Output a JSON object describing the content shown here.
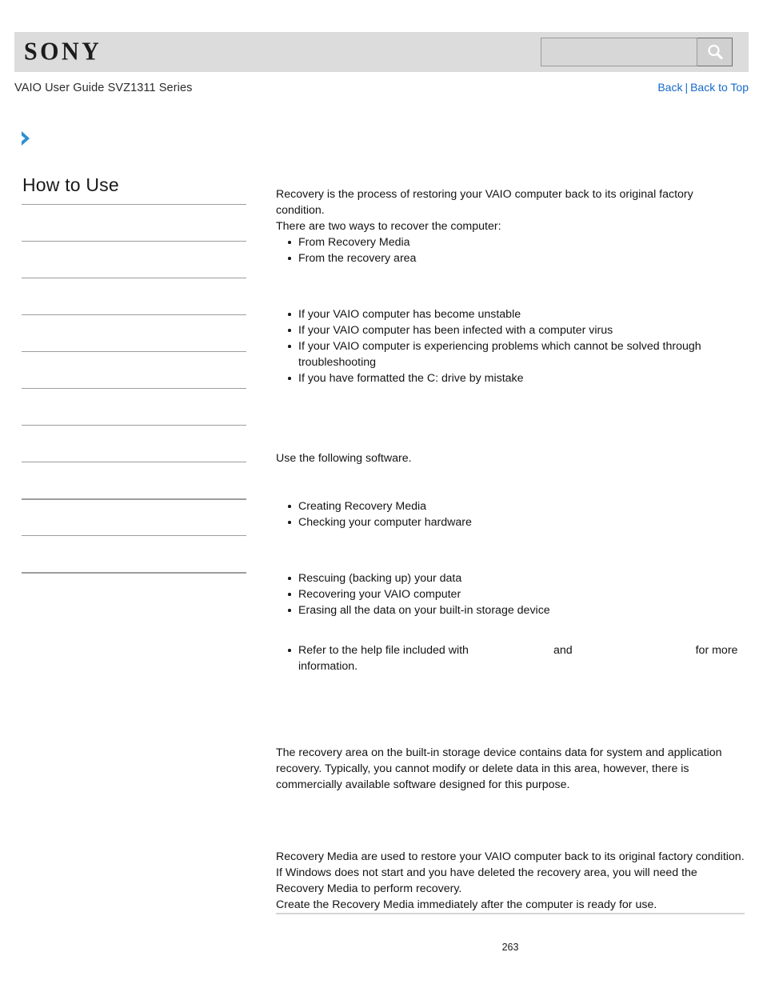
{
  "header": {
    "logo_text": "SONY",
    "search": {
      "value": "",
      "placeholder": "",
      "icon": "search-icon"
    }
  },
  "breadcrumb": {
    "guide_title": "VAIO User Guide SVZ1311 Series",
    "back_label": "Back",
    "separator": "|",
    "back_to_top_label": "Back to Top"
  },
  "sidebar": {
    "expand_icon": "chevron-right-icon",
    "heading": "How to Use",
    "items": [
      {
        "label": ""
      },
      {
        "label": ""
      },
      {
        "label": ""
      },
      {
        "label": ""
      },
      {
        "label": ""
      },
      {
        "label": ""
      },
      {
        "label": ""
      },
      {
        "label": ""
      },
      {
        "label": ""
      },
      {
        "label": ""
      },
      {
        "label": ""
      }
    ]
  },
  "content": {
    "intro_line_1": "Recovery is the process of restoring your VAIO computer back to its original factory condition.",
    "intro_line_2": "There are two ways to recover the computer:",
    "recover_ways": [
      "From Recovery Media",
      "From the recovery area"
    ],
    "section_when_heading": "",
    "when_to_recover": [
      "If your VAIO computer has become unstable",
      "If your VAIO computer has been infected with a computer virus",
      "If your VAIO computer is experiencing problems which cannot be solved through troubleshooting",
      "If you have formatted the C: drive by mistake"
    ],
    "section_software_heading": "",
    "software_intro": "Use the following software.",
    "software_group_1_heading": "",
    "software_group_1": [
      "Creating Recovery Media",
      "Checking your computer hardware"
    ],
    "software_group_2_heading": "",
    "software_group_2": [
      "Rescuing (backing up) your data",
      "Recovering your VAIO computer",
      "Erasing all the data on your built-in storage device"
    ],
    "note_prefix": "Refer to the help file included with",
    "note_blank_1": "",
    "note_middle": "and",
    "note_blank_2": "",
    "note_suffix": "for more information.",
    "section_recovery_area_heading": "",
    "recovery_area_text": "The recovery area on the built-in storage device contains data for system and application recovery. Typically, you cannot modify or delete data in this area, however, there is commercially available software designed for this purpose.",
    "section_recovery_media_heading": "",
    "recovery_media_line_1": "Recovery Media are used to restore your VAIO computer back to its original factory condition. If Windows does not start and you have deleted the recovery area, you will need the Recovery Media to perform recovery.",
    "recovery_media_line_2": "Create the Recovery Media immediately after the computer is ready for use."
  },
  "footer": {
    "page_number": "263"
  },
  "colors": {
    "header_background": "#dcdcdc",
    "link_blue": "#1769c9",
    "arrow_blue": "#2f8fd0",
    "rule_gray": "#9d9d9d",
    "footer_rule": "#d5d5d5"
  }
}
